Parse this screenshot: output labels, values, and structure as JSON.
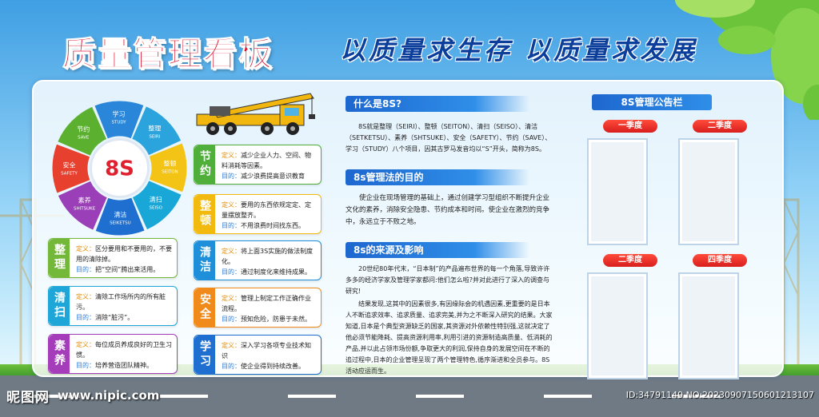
{
  "header": {
    "title": "质量管理看板",
    "slogan": "以质量求生存 以质量求发展"
  },
  "wheel": {
    "center": "8S",
    "segments": [
      {
        "cn": "学习",
        "en": "STUDY",
        "color": "#2a86d8"
      },
      {
        "cn": "整理",
        "en": "SEIRI",
        "color": "#2ba3dc"
      },
      {
        "cn": "整顿",
        "en": "SEITON",
        "color": "#f3c316"
      },
      {
        "cn": "清扫",
        "en": "SEISO",
        "color": "#19a7d8"
      },
      {
        "cn": "清洁",
        "en": "SEIKETSU",
        "color": "#1e6fcf"
      },
      {
        "cn": "素养",
        "en": "SHITSUKE",
        "color": "#9b3fb8"
      },
      {
        "cn": "安全",
        "en": "SAFETY",
        "color": "#e8402f"
      },
      {
        "cn": "节约",
        "en": "SAVE",
        "color": "#5bb12f"
      }
    ]
  },
  "cards_left": [
    {
      "tag": "整理",
      "color": "#74b83a",
      "def_label": "定义：",
      "def": "区分要用和不要用的，不要用的清除掉。",
      "goal_label": "目的：",
      "goal": "把“空间”腾出来活用。"
    },
    {
      "tag": "清扫",
      "color": "#1ea6d8",
      "def_label": "定义：",
      "def": "清除工作场所内的所有脏污。",
      "goal_label": "目的：",
      "goal": "消除“脏污”。"
    },
    {
      "tag": "素养",
      "color": "#a53dbb",
      "def_label": "定义：",
      "def": "每位成员养成良好的卫生习惯。",
      "goal_label": "目的：",
      "goal": "培养营造团队精神。"
    }
  ],
  "cards_right": [
    {
      "tag": "节约",
      "color": "#4faf3a",
      "def_label": "定义：",
      "def": "减少企业人力、空间、物料消耗等因素。",
      "goal_label": "目的：",
      "goal": "减少浪费提高意识教育"
    },
    {
      "tag": "整顿",
      "color": "#f2b90f",
      "def_label": "定义：",
      "def": "要用的东西依规定定、定量摆放整齐。",
      "goal_label": "目的：",
      "goal": "不用浪费时间找东西。"
    },
    {
      "tag": "清洁",
      "color": "#1e8fd8",
      "def_label": "定义：",
      "def": "将上面3S实施的做法制度化。",
      "goal_label": "目的：",
      "goal": "通过制度化来维持成果。"
    },
    {
      "tag": "安全",
      "color": "#f08a1a",
      "def_label": "定义：",
      "def": "管理上制定工作正确作业流程。",
      "goal_label": "目的：",
      "goal": "预知危险，防患于未然。"
    },
    {
      "tag": "学习",
      "color": "#1e6fcf",
      "def_label": "定义：",
      "def": "深入学习各项专业技术知识",
      "goal_label": "目的：",
      "goal": "使企业得到持续改善。"
    }
  ],
  "what": {
    "heading": "什么是8S?",
    "text": "8S就是整理（SEIRI）、整顿（SEITON）、清扫（SEISO）、清洁（SETKETSU）、素养（SHTSUKE）、安全（SAFETY）、节约（SAVE）、学习（STUDY）八个项目，因其古罗马发音均以“S”开头，简称为8S。"
  },
  "purpose": {
    "heading": "8s管理法的目的",
    "text": "使企业在现场管理的基础上，通过创建学习型组织不断提升企业文化的素养，消除安全隐患、节约成本和时间。使企业在激烈的竞争中，永远立于不败之地。"
  },
  "origin": {
    "heading": "8s的来源及影响",
    "p1": "20世纪80年代末，“日本制”的产品遍布世界的每一个角落,导致许许多多的经济学家及管理学家都问:他们怎么啦?并对此进行了深入的调查与研究!",
    "p2": "结果发现,这其中的因素很多,有因缘际会的机遇因素,更重要的是日本人不断追求效率、追求质量、追求完美,并为之不断深入研究的结果。大家知道,日本是个典型资源缺乏的国家,其资源对外依赖性特别强,这就决定了他必须节能降耗、提高资源利用率,利用引进的资源制造高质量、低消耗的产品,并以此占领市场份额,争取更大的利润,保持自身的发展空间在不断的追过程中,日本的企业管理呈现了两个管理特色,循序渐进和全员参与。8S活动应运而生。"
  },
  "notice": {
    "heading": "8S管理公告栏",
    "quarters": [
      "一季度",
      "二季度",
      "二季度",
      "四季度"
    ]
  },
  "watermark": {
    "site": "昵图网",
    "url": "www.nipic.com",
    "id": "ID:34791149 NO:20230907150601213107"
  }
}
